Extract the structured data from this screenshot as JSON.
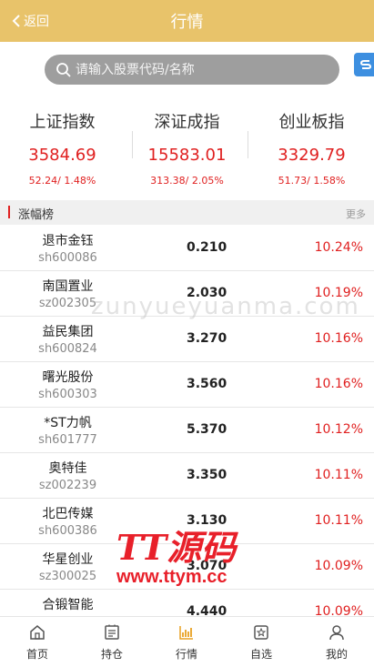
{
  "header": {
    "back_label": "返回",
    "title": "行情"
  },
  "search": {
    "placeholder": "请输入股票代码/名称"
  },
  "indices": [
    {
      "name": "上证指数",
      "value": "3584.69",
      "change": "52.24/ 1.48%"
    },
    {
      "name": "深证成指",
      "value": "15583.01",
      "change": "313.38/ 2.05%"
    },
    {
      "name": "创业板指",
      "value": "3329.79",
      "change": "51.73/ 1.58%"
    }
  ],
  "section": {
    "title": "涨幅榜",
    "more": "更多"
  },
  "stocks": [
    {
      "name": "退市金钰",
      "code": "sh600086",
      "price": "0.210",
      "pct": "10.24%"
    },
    {
      "name": "南国置业",
      "code": "sz002305",
      "price": "2.030",
      "pct": "10.19%"
    },
    {
      "name": "益民集团",
      "code": "sh600824",
      "price": "3.270",
      "pct": "10.16%"
    },
    {
      "name": "曙光股份",
      "code": "sh600303",
      "price": "3.560",
      "pct": "10.16%"
    },
    {
      "name": "*ST力帆",
      "code": "sh601777",
      "price": "5.370",
      "pct": "10.12%"
    },
    {
      "name": "奥特佳",
      "code": "sz002239",
      "price": "3.350",
      "pct": "10.11%"
    },
    {
      "name": "北巴传媒",
      "code": "sh600386",
      "price": "3.130",
      "pct": "10.11%"
    },
    {
      "name": "华星创业",
      "code": "sz300025",
      "price": "3.070",
      "pct": "10.09%"
    },
    {
      "name": "合锻智能",
      "code": "",
      "price": "4.440",
      "pct": "10.09%"
    }
  ],
  "tabbar": [
    {
      "label": "首页",
      "icon": "home-icon"
    },
    {
      "label": "持仓",
      "icon": "holdings-icon"
    },
    {
      "label": "行情",
      "icon": "market-chart-icon"
    },
    {
      "label": "自选",
      "icon": "favorites-icon"
    },
    {
      "label": "我的",
      "icon": "profile-icon"
    }
  ],
  "watermark": {
    "text": "zunyueyuanma.com"
  },
  "logo": {
    "big": "TT源码",
    "url": "www.ttym.cc"
  },
  "colors": {
    "header": "#e8c36a",
    "up": "#e02020",
    "accent": "#3d8fe0"
  }
}
